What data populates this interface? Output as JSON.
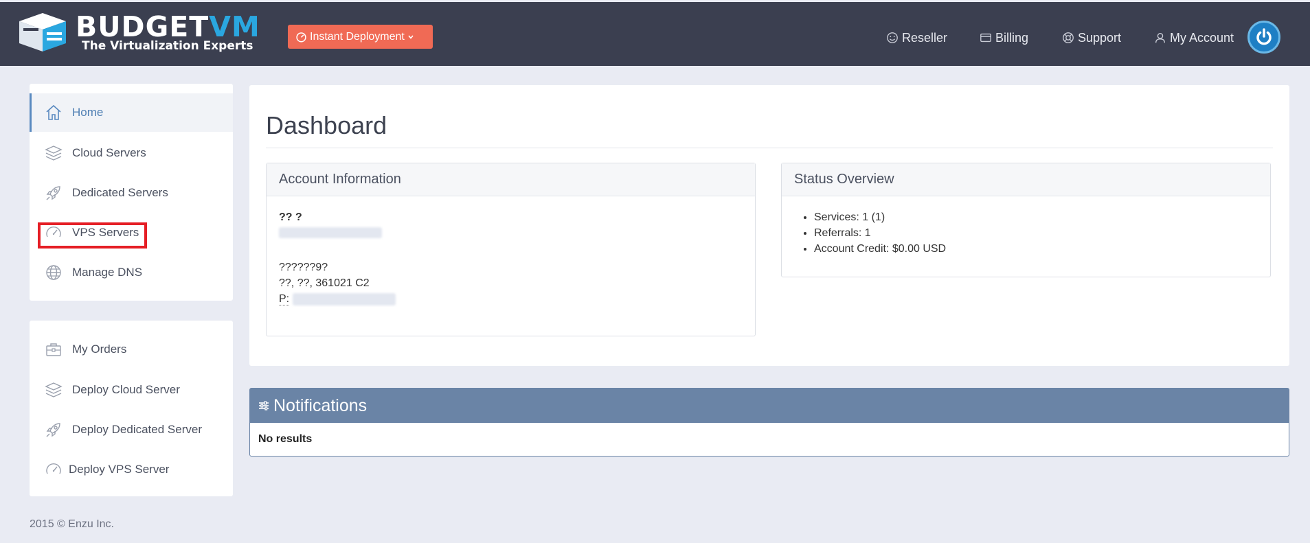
{
  "header": {
    "brand_part1": "BUDGET",
    "brand_part2": "VM",
    "tagline": "The Virtualization Experts",
    "deploy_button": "Instant Deployment",
    "nav": [
      {
        "label": "Reseller",
        "icon": "smile-icon"
      },
      {
        "label": "Billing",
        "icon": "credit-card-icon"
      },
      {
        "label": "Support",
        "icon": "lifebuoy-icon"
      },
      {
        "label": "My Account",
        "icon": "user-icon"
      }
    ],
    "power_icon": "power-icon"
  },
  "sidebar": {
    "main_items": [
      {
        "label": "Home",
        "icon": "home-icon",
        "active": true
      },
      {
        "label": "Cloud Servers",
        "icon": "layers-icon"
      },
      {
        "label": "Dedicated Servers",
        "icon": "rocket-icon"
      },
      {
        "label": "VPS Servers",
        "icon": "speedometer-icon",
        "highlighted": true
      },
      {
        "label": "Manage DNS",
        "icon": "globe-icon"
      }
    ],
    "secondary_items": [
      {
        "label": "My Orders",
        "icon": "briefcase-icon"
      },
      {
        "label": "Deploy Cloud Server",
        "icon": "layers-icon"
      },
      {
        "label": "Deploy Dedicated Server",
        "icon": "rocket-icon"
      },
      {
        "label": "Deploy VPS Server",
        "icon": "speedometer-icon"
      }
    ]
  },
  "footer": {
    "text": "2015 © Enzu Inc."
  },
  "dashboard": {
    "title": "Dashboard",
    "account_info": {
      "heading": "Account Information",
      "name": "?? ?",
      "address_line1": "??????9?",
      "address_line2": "??, ??, 361021 C2",
      "phone_label": "P:"
    },
    "status_overview": {
      "heading": "Status Overview",
      "items": [
        "Services: 1 (1)",
        "Referrals: 1",
        "Account Credit: $0.00 USD"
      ]
    }
  },
  "notifications": {
    "heading": "Notifications",
    "empty_text": "No results"
  },
  "colors": {
    "topbar": "#3b3f50",
    "accent_button": "#f06a55",
    "brand_blue": "#2aa7e0",
    "notification_header": "#6a84a6",
    "highlight_box": "#e51e25"
  }
}
